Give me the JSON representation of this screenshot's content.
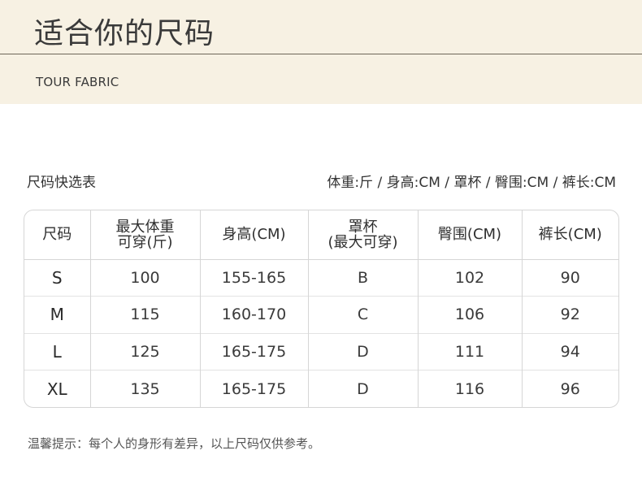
{
  "header": {
    "title": "适合你的尺码",
    "brand": "TOUR FABRIC"
  },
  "quick_table": {
    "title": "尺码快选表",
    "unit_legend": "体重:斤 / 身高:CM / 罩杯 / 臀围:CM / 裤长:CM"
  },
  "table": {
    "headers": {
      "size": "尺码",
      "weight_line1": "最大体重",
      "weight_line2": "可穿(斤)",
      "height": "身高(CM)",
      "cup_line1": "罩杯",
      "cup_line2": "(最大可穿)",
      "hip": "臀围(CM)",
      "length": "裤长(CM)"
    },
    "rows": [
      {
        "size": "S",
        "weight": "100",
        "height": "155-165",
        "cup": "B",
        "hip": "102",
        "length": "90"
      },
      {
        "size": "M",
        "weight": "115",
        "height": "160-170",
        "cup": "C",
        "hip": "106",
        "length": "92"
      },
      {
        "size": "L",
        "weight": "125",
        "height": "165-175",
        "cup": "D",
        "hip": "111",
        "length": "94"
      },
      {
        "size": "XL",
        "weight": "135",
        "height": "165-175",
        "cup": "D",
        "hip": "116",
        "length": "96"
      }
    ]
  },
  "note": "温馨提示：每个人的身形有差异，以上尺码仅供参考。"
}
